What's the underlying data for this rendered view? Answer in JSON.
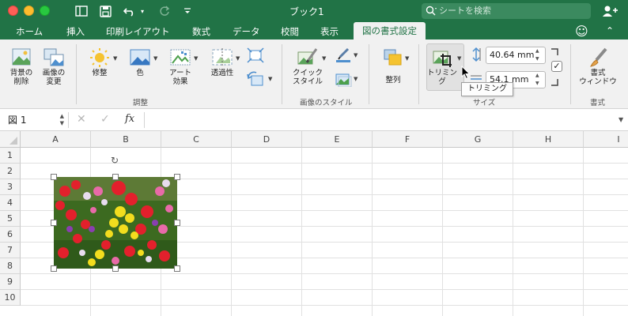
{
  "app": {
    "doc_title": "ブック1",
    "search_placeholder": "シートを検索"
  },
  "tabs": [
    "ホーム",
    "挿入",
    "印刷レイアウト",
    "数式",
    "データ",
    "校閲",
    "表示",
    "図の書式設定"
  ],
  "active_tab": "図の書式設定",
  "ribbon": {
    "remove_bg": "背景の\n削除",
    "change_picture": "画像の\n変更",
    "corrections": "修整",
    "color": "色",
    "artistic": "アート\n効果",
    "transparency": "透過性",
    "adjust_group": "調整",
    "quick_styles": "クイック\nスタイル",
    "styles_group": "画像のスタイル",
    "arrange": "整列",
    "crop": "トリミング",
    "height_value": "40.64 mm",
    "width_value": "54.1 mm",
    "size_group": "サイズ",
    "format_pane": "書式\nウィンドウ",
    "format_group": "書式",
    "tooltip": "トリミング"
  },
  "formula_bar": {
    "name_box": "図 1",
    "fx": "fx",
    "cancel": "✕",
    "enter": "✓"
  },
  "columns": [
    "A",
    "B",
    "C",
    "D",
    "E",
    "F",
    "G",
    "H",
    "I"
  ],
  "rows": [
    "1",
    "2",
    "3",
    "4",
    "5",
    "6",
    "7",
    "8",
    "9",
    "10"
  ],
  "colors": {
    "excel_green": "#217346",
    "ribbon_bg": "#f1f1f1"
  }
}
